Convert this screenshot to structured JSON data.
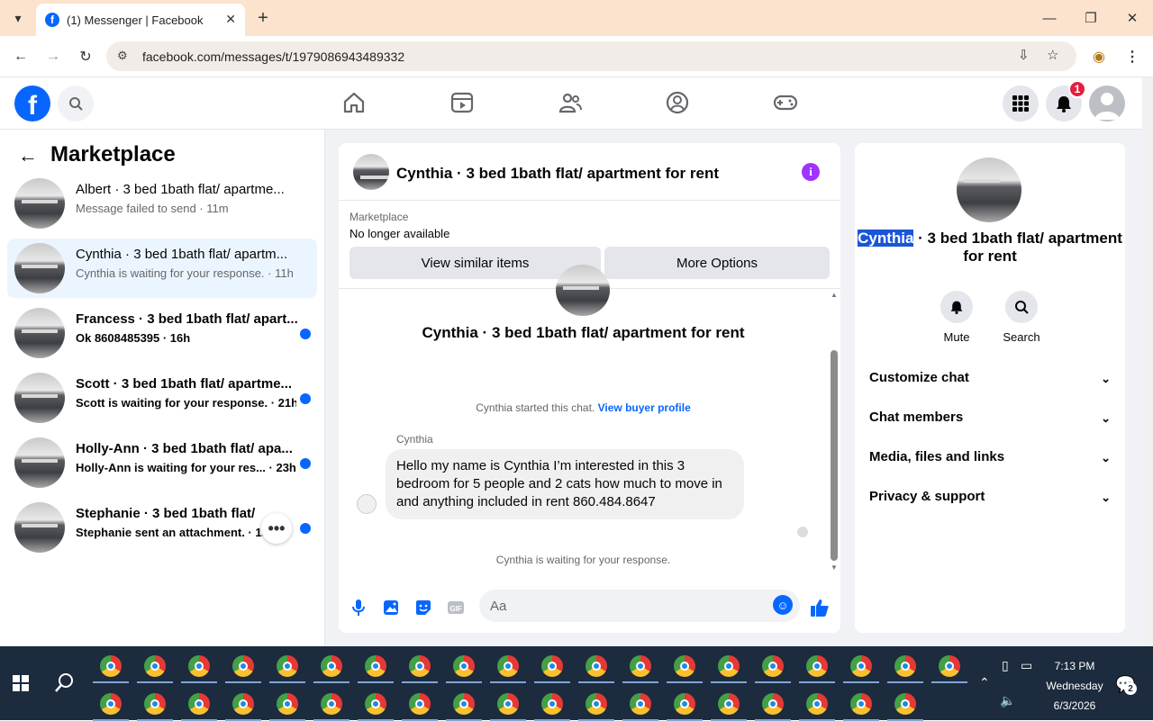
{
  "browser": {
    "tab_title": "(1) Messenger | Facebook",
    "tab_favicon": "f",
    "url": "facebook.com/messages/t/1979086943489332"
  },
  "header": {
    "notification_count": "1"
  },
  "sidebar": {
    "title": "Marketplace",
    "chats": [
      {
        "name": "Albert · 3 bed 1bath flat/ apartme...",
        "sub": "Message failed to send · 11m",
        "unread": false,
        "active": false
      },
      {
        "name": "Cynthia · 3 bed 1bath flat/ apartm...",
        "sub": "Cynthia is waiting for your response. · 11h",
        "unread": false,
        "active": true
      },
      {
        "name": "Francess · 3 bed 1bath flat/ apart...",
        "sub": "Ok 8608485395 · 16h",
        "unread": true,
        "active": false
      },
      {
        "name": "Scott · 3 bed 1bath flat/ apartme...",
        "sub": "Scott is waiting for your response. · 21h",
        "unread": true,
        "active": false
      },
      {
        "name": "Holly-Ann · 3 bed 1bath flat/ apa...",
        "sub": "Holly-Ann is waiting for your res... · 23h",
        "unread": true,
        "active": false
      },
      {
        "name": "Stephanie · 3 bed 1bath flat/ ap",
        "sub": "Stephanie sent an attachment. · 1d",
        "unread": true,
        "active": false
      }
    ],
    "more_label": "•••"
  },
  "conversation": {
    "title": "Cynthia · 3 bed 1bath flat/ apartment for rent",
    "marketplace_label": "Marketplace",
    "status": "No longer available",
    "btn_similar": "View similar items",
    "btn_options": "More Options",
    "big_title": "Cynthia · 3 bed 1bath flat/ apartment for rent",
    "started_text": "Cynthia started this chat.",
    "buyer_link": "View buyer profile",
    "sender": "Cynthia",
    "message": "Hello my name is Cynthia I’m interested in this 3 bedroom for 5 people and 2 cats how much to move in and anything included in rent 860.484.8647",
    "waiting": "Cynthia is waiting for your response.",
    "composer_placeholder": "Aa"
  },
  "details": {
    "name_highlight": "Cynthia",
    "name_rest": " · 3 bed 1bath flat/ apartment for rent",
    "mute_label": "Mute",
    "search_label": "Search",
    "sections": [
      "Customize chat",
      "Chat members",
      "Media, files and links",
      "Privacy & support"
    ]
  },
  "taskbar": {
    "time": "7:13 PM",
    "day": "Wednesday",
    "date": "6/3/2026",
    "notif_count": "2"
  },
  "colors": {
    "fb_blue": "#0866ff",
    "info_purple": "#a033ff",
    "badge_red": "#e41e3f",
    "taskbar": "#1c2b3e"
  }
}
